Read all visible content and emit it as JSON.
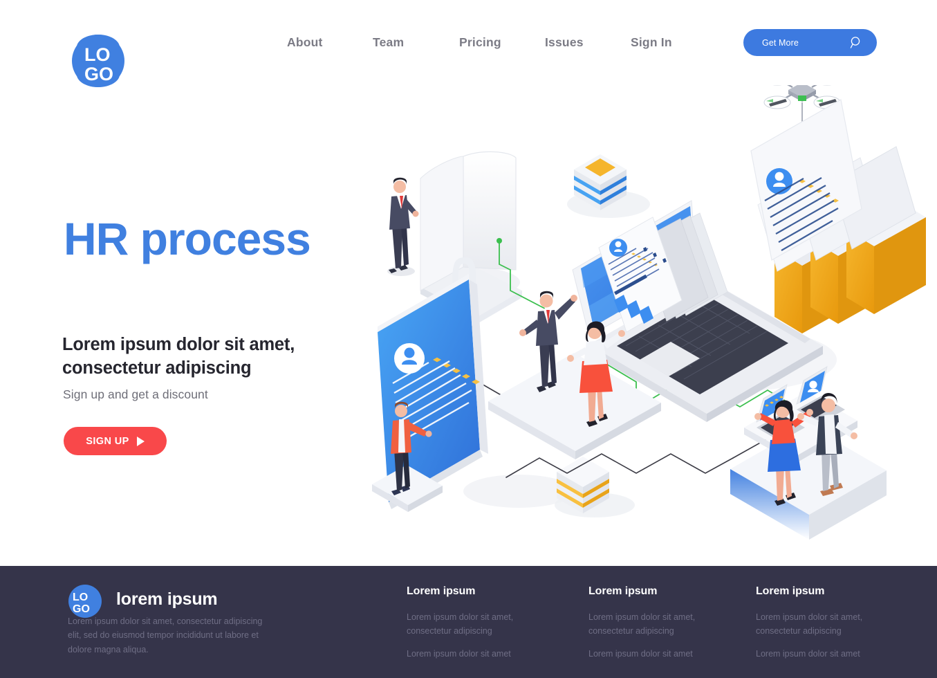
{
  "header": {
    "logo": {
      "line1": "LO",
      "line2": "GO",
      "name": "logo-icon",
      "color": "#4080e0"
    },
    "nav": [
      {
        "label": "About"
      },
      {
        "label": "Team"
      },
      {
        "label": "Pricing"
      },
      {
        "label": "Issues"
      },
      {
        "label": "Sign In"
      }
    ],
    "cta": {
      "label": "Get More",
      "icon": "search-icon",
      "color": "#3d7ae0"
    }
  },
  "hero": {
    "title": "HR process",
    "subtitle": "Lorem ipsum dolor sit amet, consectetur adipiscing",
    "note": "Sign up and get a discount",
    "button": {
      "label": "SIGN UP",
      "icon": "play-icon",
      "color": "#f9484a"
    }
  },
  "illustration": {
    "name": "hr-process-isometric-illustration",
    "elements": [
      "desktop-monitor-back",
      "businessman-standing",
      "card-stack-blue",
      "card-stack-yellow",
      "laptop-with-cv-cards",
      "orange-folder-row",
      "drone-delivering-cv",
      "cv-card-large",
      "blue-screen-with-review",
      "worker-orange-vest",
      "recruiter-man-and-woman",
      "workstation-two-people"
    ],
    "rating_stars": 5,
    "colors": {
      "screen_blue": "#3d8ef0",
      "folder_orange": "#f2a819",
      "star_yellow": "#f5c043",
      "cable_green": "#3ec751",
      "cable_dark": "#3b3b45"
    }
  },
  "footer": {
    "logo": {
      "line1": "LO",
      "line2": "GO",
      "name": "footer-logo-icon"
    },
    "brand": "lorem ipsum",
    "description": "Lorem ipsum dolor sit amet, consectetur adipiscing elit, sed do eiusmod tempor incididunt ut labore et dolore magna aliqua.",
    "columns": [
      {
        "heading": "Lorem ipsum",
        "links": [
          "Lorem ipsum dolor sit amet, consectetur adipiscing",
          "Lorem ipsum dolor sit amet"
        ]
      },
      {
        "heading": "Lorem ipsum",
        "links": [
          "Lorem ipsum dolor sit amet, consectetur adipiscing",
          "Lorem ipsum dolor sit amet"
        ]
      },
      {
        "heading": "Lorem ipsum",
        "links": [
          "Lorem ipsum dolor sit amet, consectetur adipiscing",
          "Lorem ipsum dolor sit amet"
        ]
      }
    ],
    "background": "#35344a"
  }
}
